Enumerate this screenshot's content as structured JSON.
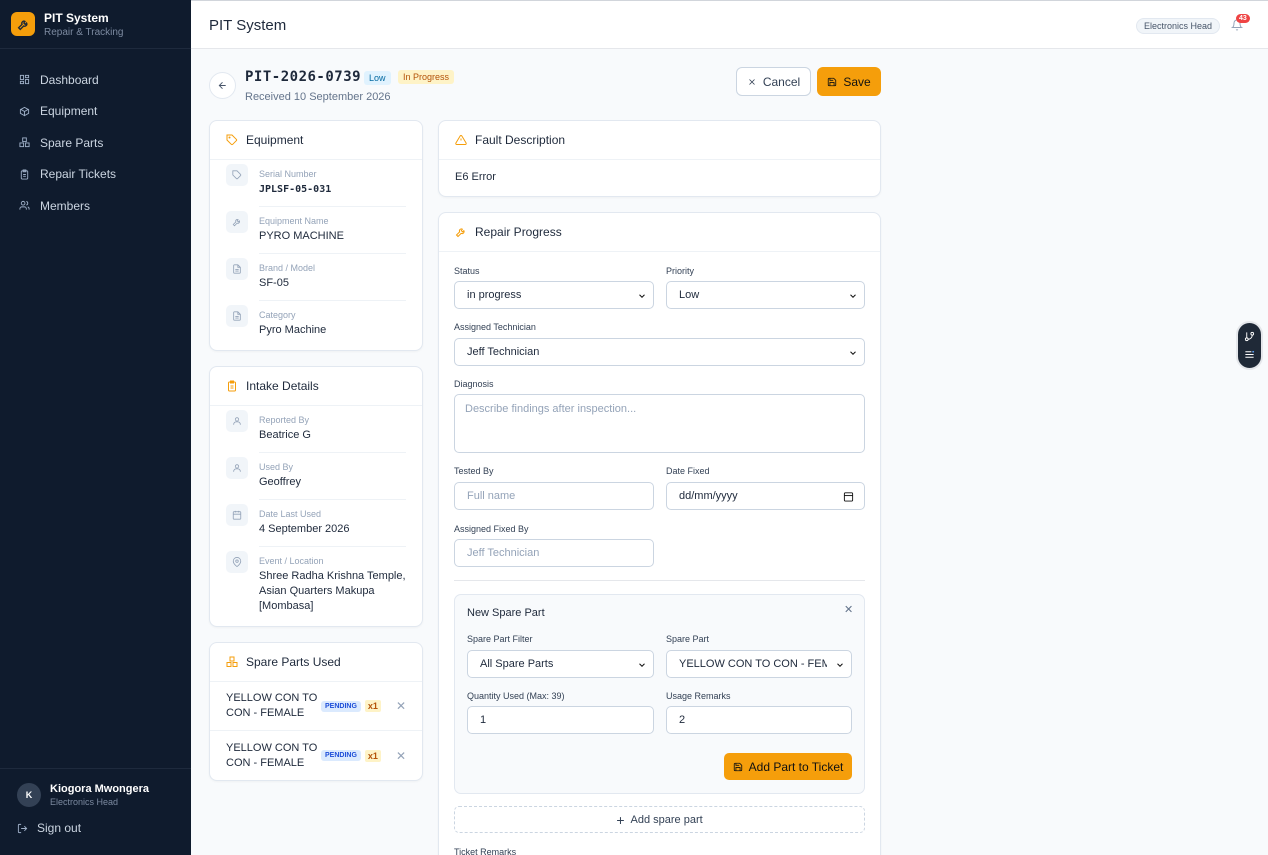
{
  "app": {
    "title": "PIT System",
    "subtitle": "Repair & Tracking"
  },
  "nav": [
    {
      "label": "Dashboard",
      "icon": "grid-icon"
    },
    {
      "label": "Equipment",
      "icon": "box-icon"
    },
    {
      "label": "Spare Parts",
      "icon": "cubes-icon"
    },
    {
      "label": "Repair Tickets",
      "icon": "clipboard-icon"
    },
    {
      "label": "Members",
      "icon": "users-icon"
    }
  ],
  "user": {
    "initial": "K",
    "name": "Kiogora Mwongera",
    "role": "Electronics Head",
    "signout": "Sign out"
  },
  "topbar": {
    "title": "PIT System",
    "role_chip": "Electronics Head",
    "notifications": "43"
  },
  "ticket": {
    "id": "PIT-2026-0739",
    "priority_badge": "Low",
    "status_badge": "In Progress",
    "received": "Received 10 September 2026",
    "cancel_label": "Cancel",
    "save_label": "Save"
  },
  "equipment": {
    "title": "Equipment",
    "fields": [
      {
        "label": "Serial Number",
        "value": "JPLSF-05-031"
      },
      {
        "label": "Equipment Name",
        "value": "PYRO MACHINE"
      },
      {
        "label": "Brand / Model",
        "value": "SF-05"
      },
      {
        "label": "Category",
        "value": "Pyro Machine"
      }
    ]
  },
  "intake": {
    "title": "Intake Details",
    "fields": [
      {
        "label": "Reported By",
        "value": "Beatrice G"
      },
      {
        "label": "Used By",
        "value": "Geoffrey"
      },
      {
        "label": "Date Last Used",
        "value": "4 September 2026"
      },
      {
        "label": "Event / Location",
        "value": "Shree Radha Krishna Temple, Asian Quarters Makupa [Mombasa]"
      }
    ]
  },
  "spare_parts_used": {
    "title": "Spare Parts Used",
    "items": [
      {
        "name": "YELLOW CON TO CON - FEMALE",
        "status": "PENDING",
        "qty": "x1"
      },
      {
        "name": "YELLOW CON TO CON - FEMALE",
        "status": "PENDING",
        "qty": "x1"
      }
    ]
  },
  "fault": {
    "title": "Fault Description",
    "text": "E6 Error"
  },
  "repair": {
    "title": "Repair Progress",
    "status_label": "Status",
    "status_value": "in progress",
    "priority_label": "Priority",
    "priority_value": "Low",
    "technician_label": "Assigned Technician",
    "technician_value": "Jeff Technician",
    "diagnosis_label": "Diagnosis",
    "diagnosis_placeholder": "Describe findings after inspection...",
    "tested_by_label": "Tested By",
    "tested_by_placeholder": "Full name",
    "date_fixed_label": "Date Fixed",
    "date_fixed_placeholder": "dd/mm/yyyy",
    "fixed_by_label": "Assigned Fixed By",
    "fixed_by_value": "Jeff Technician"
  },
  "new_part": {
    "title": "New Spare Part",
    "filter_label": "Spare Part Filter",
    "filter_value": "All Spare Parts",
    "part_label": "Spare Part",
    "part_value": "YELLOW CON TO CON - FEMALE",
    "qty_label": "Quantity Used (Max: 39)",
    "qty_value": "1",
    "remarks_label": "Usage Remarks",
    "remarks_value": "2",
    "add_button": "Add Part to Ticket",
    "add_spare_part": "Add spare part",
    "ticket_remarks_label": "Ticket Remarks"
  },
  "colors": {
    "accent": "#f59e0b",
    "sidebar": "#0f1b2d"
  }
}
